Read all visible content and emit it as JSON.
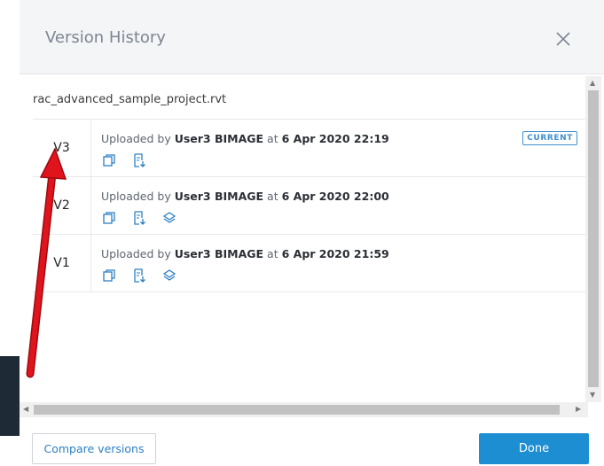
{
  "dialog": {
    "title": "Version History",
    "file_name": "rac_advanced_sample_project.rvt",
    "compare_label": "Compare versions",
    "done_label": "Done"
  },
  "versions": [
    {
      "label": "V3",
      "uploaded_prefix": "Uploaded by ",
      "user": "User3 BIMAGE",
      "at_text": " at ",
      "date": "6 Apr 2020 22:19",
      "badge": "CURRENT",
      "icons": [
        "copy-icon",
        "file-download-icon"
      ]
    },
    {
      "label": "V2",
      "uploaded_prefix": "Uploaded by ",
      "user": "User3 BIMAGE",
      "at_text": " at ",
      "date": "6 Apr 2020 22:00",
      "icons": [
        "copy-icon",
        "file-download-icon",
        "layers-icon"
      ]
    },
    {
      "label": "V1",
      "uploaded_prefix": "Uploaded by ",
      "user": "User3 BIMAGE",
      "at_text": " at ",
      "date": "6 Apr 2020 21:59",
      "icons": [
        "copy-icon",
        "file-download-icon",
        "layers-icon"
      ]
    }
  ],
  "colors": {
    "accent": "#1e8ed3",
    "badge": "#3f8fce",
    "annotation_arrow": "#e0141c"
  }
}
